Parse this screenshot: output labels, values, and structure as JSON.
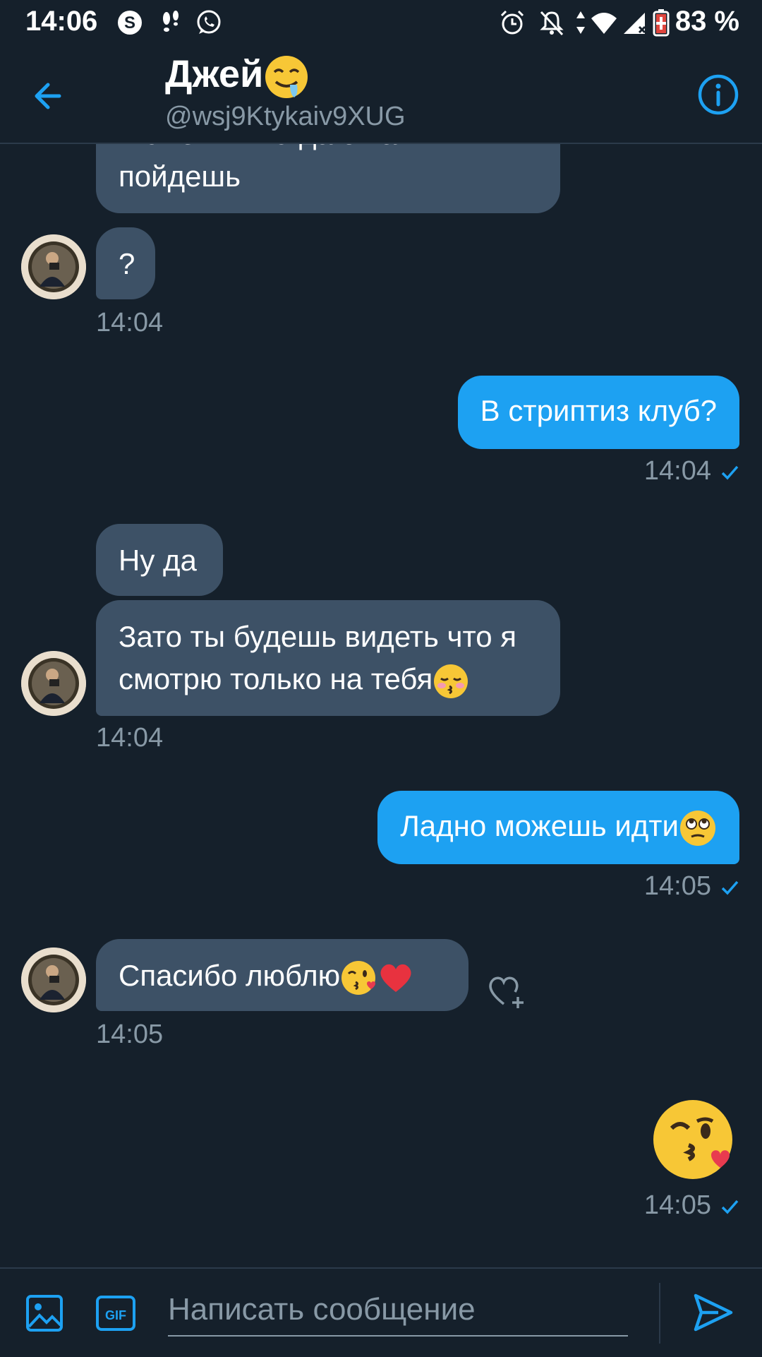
{
  "status_bar": {
    "time": "14:06",
    "battery": "83 %",
    "icons": [
      "skype-icon",
      "footsteps-icon",
      "whatsapp-icon",
      "alarm-icon",
      "notifications-off-icon",
      "data-arrows-icon",
      "wifi-icon",
      "signal-icon",
      "battery-charging-icon"
    ]
  },
  "header": {
    "name": "Джей",
    "name_emoji": "drooling-face-icon",
    "handle": "@wsj9Ktykaiv9XUG"
  },
  "messages": [
    {
      "dir": "in",
      "text": "Может ты тогда с нами пойдешь"
    },
    {
      "dir": "in",
      "text": "?",
      "time": "14:04"
    },
    {
      "dir": "out",
      "text": "В стриптиз клуб?",
      "time": "14:04",
      "read": true
    },
    {
      "dir": "in",
      "text": "Ну да"
    },
    {
      "dir": "in",
      "text": "Зато ты будешь видеть что я смотрю только на тебя",
      "emoji": "kissing-face-icon",
      "time": "14:04"
    },
    {
      "dir": "out",
      "text": "Ладно можешь идти",
      "emoji": "eye-roll-face-icon",
      "time": "14:05",
      "read": true
    },
    {
      "dir": "in",
      "text": "Спасибо люблю",
      "emoji": "kiss-heart-face-icon heart-icon",
      "time": "14:05"
    },
    {
      "dir": "out",
      "emoji": "kiss-heart-face-icon",
      "time": "14:05",
      "read": true
    }
  ],
  "composer": {
    "placeholder": "Написать сообщение",
    "gif_label": "GIF"
  },
  "colors": {
    "background": "#15202b",
    "incoming_bubble": "#3d5166",
    "outgoing_bubble": "#1da1f2",
    "accent": "#1da1f2",
    "muted_text": "#8899a6"
  }
}
